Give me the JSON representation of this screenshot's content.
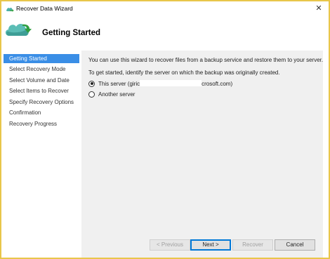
{
  "window": {
    "title": "Recover Data Wizard",
    "close_glyph": "✕"
  },
  "header": {
    "title": "Getting Started",
    "icon": "cloud-arrow-icon"
  },
  "nav": {
    "items": [
      {
        "label": "Getting Started",
        "selected": true
      },
      {
        "label": "Select Recovery Mode",
        "selected": false
      },
      {
        "label": "Select Volume and Date",
        "selected": false
      },
      {
        "label": "Select Items to Recover",
        "selected": false
      },
      {
        "label": "Specify Recovery Options",
        "selected": false
      },
      {
        "label": "Confirmation",
        "selected": false
      },
      {
        "label": "Recovery Progress",
        "selected": false
      }
    ]
  },
  "content": {
    "intro": "You can use this wizard to recover files from a backup service and restore them to your server.",
    "instruction": "To get started, identify the server on which the backup was originally created.",
    "options": [
      {
        "label_prefix": "This server (giric",
        "label_suffix": "crosoft.com)",
        "checked": true
      },
      {
        "label": "Another server",
        "checked": false
      }
    ]
  },
  "buttons": {
    "previous": {
      "label": "< Previous",
      "enabled": false
    },
    "next": {
      "label": "Next >",
      "enabled": true
    },
    "recover": {
      "label": "Recover",
      "enabled": false
    },
    "cancel": {
      "label": "Cancel",
      "enabled": true
    }
  },
  "colors": {
    "selected_nav": "#3a8ee6",
    "content_bg": "#f0f0f0",
    "window_border": "#e8c64a"
  }
}
